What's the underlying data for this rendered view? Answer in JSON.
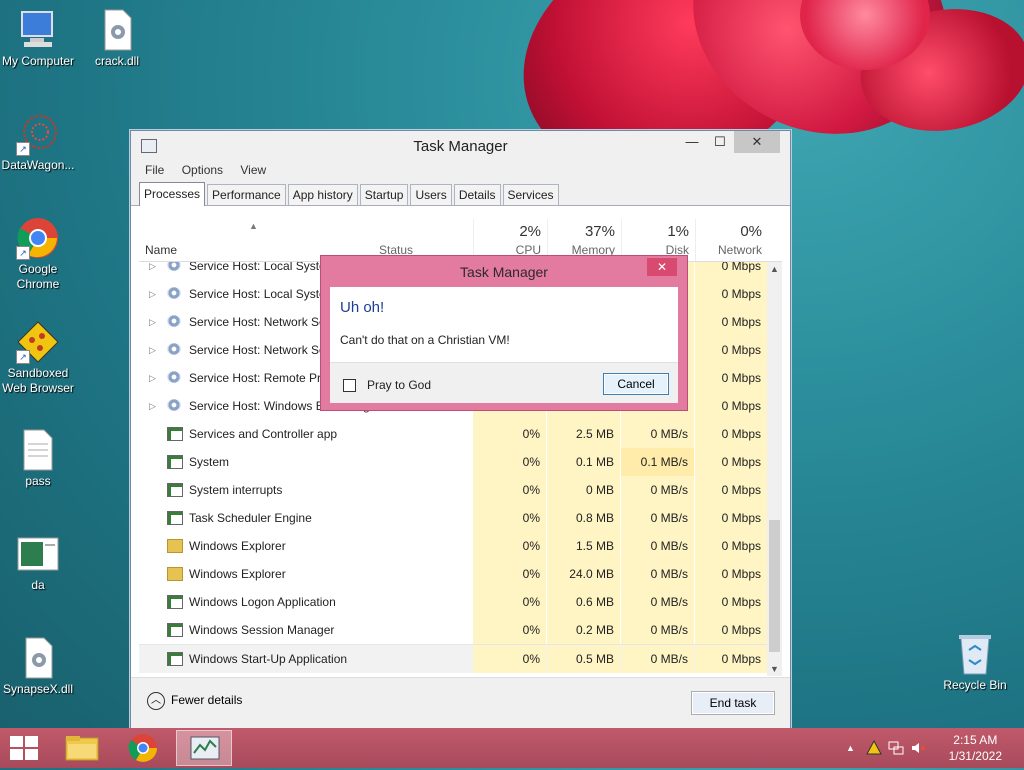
{
  "desktop": {
    "icons": [
      {
        "label": "My Computer"
      },
      {
        "label": "crack.dll"
      },
      {
        "label": "DataWagon..."
      },
      {
        "label": "Google Chrome"
      },
      {
        "label": "Sandboxed Web Browser"
      },
      {
        "label": "pass"
      },
      {
        "label": "da"
      },
      {
        "label": "SynapseX.dll"
      },
      {
        "label": "Recycle Bin"
      }
    ]
  },
  "window": {
    "title": "Task Manager",
    "menu": [
      "File",
      "Options",
      "View"
    ],
    "tabs": [
      "Processes",
      "Performance",
      "App history",
      "Startup",
      "Users",
      "Details",
      "Services"
    ],
    "active_tab": "Processes",
    "columns": {
      "name": "Name",
      "status": "Status",
      "cpu": {
        "pct": "2%",
        "label": "CPU"
      },
      "memory": {
        "pct": "37%",
        "label": "Memory"
      },
      "disk": {
        "pct": "1%",
        "label": "Disk"
      },
      "network": {
        "pct": "0%",
        "label": "Network"
      }
    },
    "rows": [
      {
        "name": "Service Host: Local System",
        "cpu": "",
        "mem": "",
        "disk": "",
        "net": "0 Mbps",
        "icon": "gear-icon",
        "expand": true
      },
      {
        "name": "Service Host: Local System",
        "cpu": "",
        "mem": "",
        "disk": "",
        "net": "0 Mbps",
        "icon": "gear-icon",
        "expand": true
      },
      {
        "name": "Service Host: Network Service",
        "cpu": "",
        "mem": "",
        "disk": "",
        "net": "0 Mbps",
        "icon": "gear-icon",
        "expand": true
      },
      {
        "name": "Service Host: Network Service",
        "cpu": "",
        "mem": "",
        "disk": "",
        "net": "0 Mbps",
        "icon": "gear-icon",
        "expand": true
      },
      {
        "name": "Service Host: Remote Procedure Call",
        "cpu": "",
        "mem": "",
        "disk": "",
        "net": "0 Mbps",
        "icon": "gear-icon",
        "expand": true
      },
      {
        "name": "Service Host: Windows Event Log",
        "cpu": "",
        "mem": "",
        "disk": "",
        "net": "0 Mbps",
        "icon": "gear-icon",
        "expand": true
      },
      {
        "name": "Services and Controller app",
        "cpu": "0%",
        "mem": "2.5 MB",
        "disk": "0 MB/s",
        "net": "0 Mbps",
        "icon": "app-icon",
        "expand": false
      },
      {
        "name": "System",
        "cpu": "0%",
        "mem": "0.1 MB",
        "disk": "0.1 MB/s",
        "net": "0 Mbps",
        "icon": "app-icon",
        "expand": false,
        "hi": true
      },
      {
        "name": "System interrupts",
        "cpu": "0%",
        "mem": "0 MB",
        "disk": "0 MB/s",
        "net": "0 Mbps",
        "icon": "app-icon",
        "expand": false
      },
      {
        "name": "Task Scheduler Engine",
        "cpu": "0%",
        "mem": "0.8 MB",
        "disk": "0 MB/s",
        "net": "0 Mbps",
        "icon": "app-icon",
        "expand": false
      },
      {
        "name": "Windows Explorer",
        "cpu": "0%",
        "mem": "1.5 MB",
        "disk": "0 MB/s",
        "net": "0 Mbps",
        "icon": "folder-icon",
        "expand": false
      },
      {
        "name": "Windows Explorer",
        "cpu": "0%",
        "mem": "24.0 MB",
        "disk": "0 MB/s",
        "net": "0 Mbps",
        "icon": "folder-icon",
        "expand": false
      },
      {
        "name": "Windows Logon Application",
        "cpu": "0%",
        "mem": "0.6 MB",
        "disk": "0 MB/s",
        "net": "0 Mbps",
        "icon": "app-icon",
        "expand": false
      },
      {
        "name": "Windows Session Manager",
        "cpu": "0%",
        "mem": "0.2 MB",
        "disk": "0 MB/s",
        "net": "0 Mbps",
        "icon": "app-icon",
        "expand": false
      },
      {
        "name": "Windows Start-Up Application",
        "cpu": "0%",
        "mem": "0.5 MB",
        "disk": "0 MB/s",
        "net": "0 Mbps",
        "icon": "app-icon",
        "expand": false,
        "selected": true
      }
    ],
    "footer": {
      "fewer": "Fewer details",
      "end_task": "End task"
    }
  },
  "dialog": {
    "title": "Task Manager",
    "heading": "Uh oh!",
    "message": "Can't do that on a Christian VM!",
    "checkbox_label": "Pray to God",
    "cancel": "Cancel"
  },
  "taskbar": {
    "time": "2:15 AM",
    "date": "1/31/2022"
  },
  "colors": {
    "taskbar": "#b0505f",
    "dialog_frame": "#e37aa0",
    "heat_cell": "#fff4c4",
    "desktop": "#2a8c9a"
  }
}
